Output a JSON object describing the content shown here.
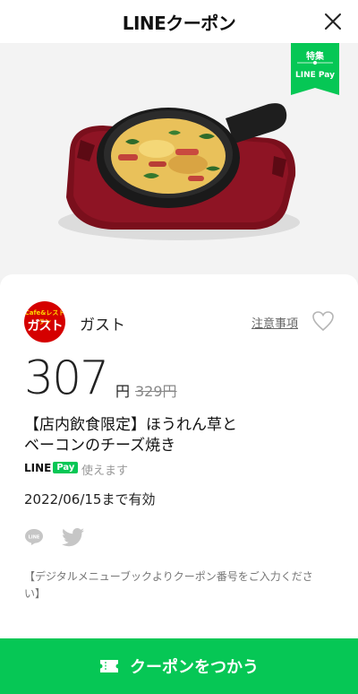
{
  "header": {
    "title": "LINEクーポン"
  },
  "badge": {
    "line1": "特集",
    "line2": "LINE Pay"
  },
  "store": {
    "logo_top": "Cafe&レストラン",
    "logo_main": "ガスト",
    "name": "ガスト",
    "notes_link": "注意事項"
  },
  "price": {
    "value": "307",
    "unit": "円",
    "original": "329円"
  },
  "coupon": {
    "title_line1": "【店内飲食限定】ほうれん草と",
    "title_line2": "ベーコンのチーズ焼き",
    "payment_line": "LINE",
    "payment_pay": "Pay",
    "payment_note": "使えます",
    "valid_until": "2022/06/15まで有効",
    "note_line1": "【デジタルメニューブックよりクーポン番号をご入力くださ",
    "note_line2": "い】"
  },
  "footer": {
    "button_label": "クーポンをつかう"
  },
  "colors": {
    "accent": "#06c755",
    "brand_red": "#d50000"
  }
}
